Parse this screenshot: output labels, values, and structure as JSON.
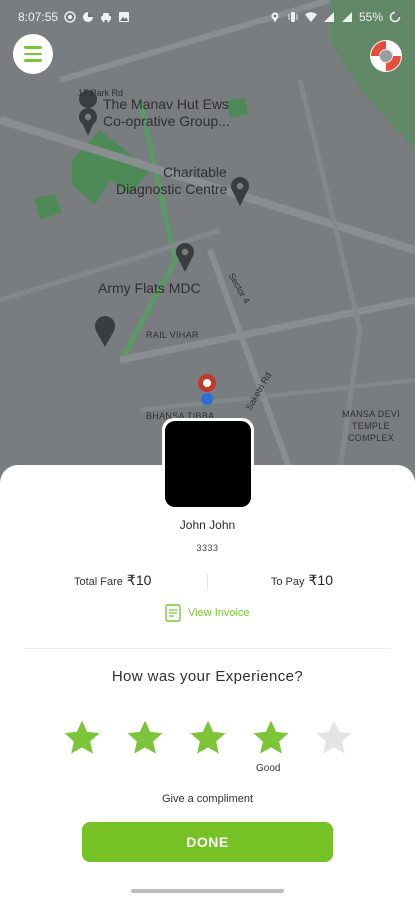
{
  "status_bar": {
    "time": "8:07:55",
    "battery": "55%"
  },
  "map": {
    "labels": {
      "park_rd": "17 Park Rd",
      "manav_hut_1": "The Manav Hut Ews",
      "manav_hut_2": "Co-oprative Group...",
      "charitable_1": "Charitable",
      "charitable_2": "Diagnostic Centre",
      "army_flats": "Army Flats MDC",
      "sector": "Sector 4",
      "rail_vihar": "RAIL VIHAR",
      "bhansa_tibba": "BHANSA TIBBA",
      "saketri_rd": "Saketri Rd",
      "mansa_1": "MANSA DEVI",
      "mansa_2": "TEMPLE",
      "mansa_3": "COMPLEX"
    }
  },
  "driver": {
    "name": "John John",
    "vehicle": "3333"
  },
  "fare": {
    "total_label": "Total Fare",
    "total_value": "₹10",
    "topay_label": "To Pay",
    "topay_value": "₹10"
  },
  "invoice": {
    "label": "View Invoice"
  },
  "rating": {
    "question": "How was your Experience?",
    "value": 4,
    "max": 5,
    "selected_word": "Good",
    "compliment": "Give a compliment"
  },
  "done_button": {
    "label": "DONE"
  },
  "colors": {
    "accent": "#7cc43a",
    "star_active": "#7cc43a",
    "star_inactive": "#e4e4e4"
  }
}
